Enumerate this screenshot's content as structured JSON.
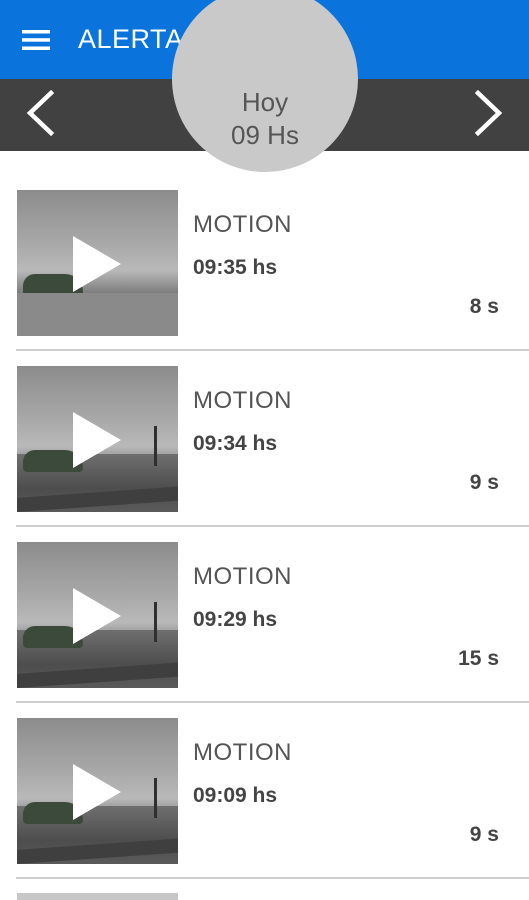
{
  "appbar": {
    "title": "ALERTAS",
    "menu_icon": "hamburger-menu-icon",
    "color": "#0a74dc"
  },
  "datebar": {
    "day": "Hoy",
    "hour": "09 Hs",
    "prev_icon": "chevron-left-icon",
    "next_icon": "chevron-right-icon",
    "color": "#414141"
  },
  "alerts": [
    {
      "type": "MOTION",
      "time": "09:35 hs",
      "duration": "8 s"
    },
    {
      "type": "MOTION",
      "time": "09:34 hs",
      "duration": "9 s"
    },
    {
      "type": "MOTION",
      "time": "09:29 hs",
      "duration": "15 s"
    },
    {
      "type": "MOTION",
      "time": "09:09 hs",
      "duration": "9 s"
    }
  ]
}
